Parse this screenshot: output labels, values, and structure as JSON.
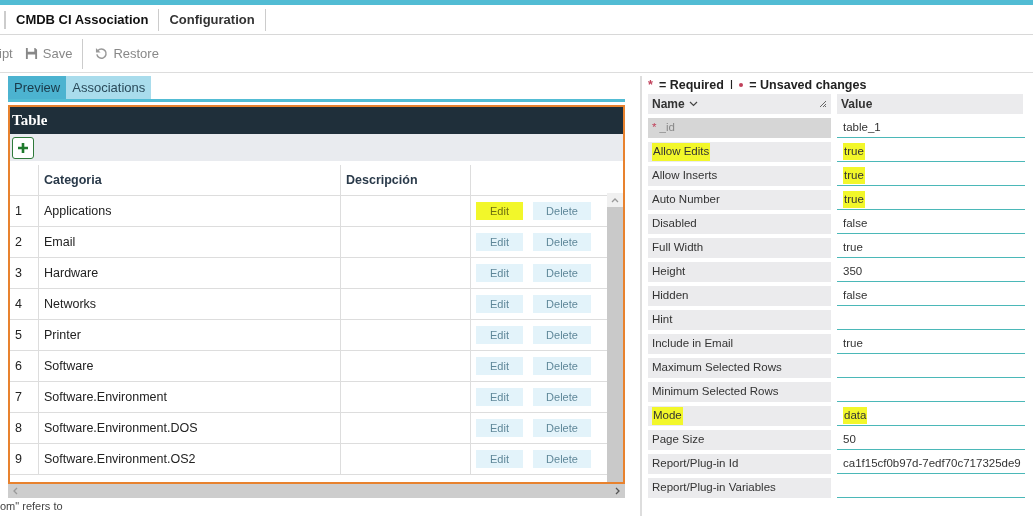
{
  "top_tabs": [
    {
      "label": "CMDB CI Association",
      "selected": true
    },
    {
      "label": "Configuration",
      "selected": false
    }
  ],
  "toolbar": [
    {
      "kind": "text",
      "label": "ipt"
    },
    {
      "kind": "save",
      "label": "Save"
    },
    {
      "kind": "restore",
      "label": "Restore"
    }
  ],
  "view_tabs": [
    {
      "label": "Preview",
      "selected": true
    },
    {
      "label": "Associations",
      "selected": false
    }
  ],
  "table": {
    "title": "Table",
    "columns": [
      "Categoria",
      "Descripción"
    ],
    "rows": [
      {
        "number": "1",
        "categoria": "Applications",
        "edit": "Edit",
        "delete": "Delete",
        "edit_highlighted": true
      },
      {
        "number": "2",
        "categoria": "Email",
        "edit": "Edit",
        "delete": "Delete",
        "edit_highlighted": false
      },
      {
        "number": "3",
        "categoria": "Hardware",
        "edit": "Edit",
        "delete": "Delete",
        "edit_highlighted": false
      },
      {
        "number": "4",
        "categoria": "Networks",
        "edit": "Edit",
        "delete": "Delete",
        "edit_highlighted": false
      },
      {
        "number": "5",
        "categoria": "Printer",
        "edit": "Edit",
        "delete": "Delete",
        "edit_highlighted": false
      },
      {
        "number": "6",
        "categoria": "Software",
        "edit": "Edit",
        "delete": "Delete",
        "edit_highlighted": false
      },
      {
        "number": "7",
        "categoria": "Software.Environment",
        "edit": "Edit",
        "delete": "Delete",
        "edit_highlighted": false
      },
      {
        "number": "8",
        "categoria": "Software.Environment.DOS",
        "edit": "Edit",
        "delete": "Delete",
        "edit_highlighted": false
      },
      {
        "number": "9",
        "categoria": "Software.Environment.OS2",
        "edit": "Edit",
        "delete": "Delete",
        "edit_highlighted": false
      }
    ]
  },
  "legend": {
    "required_mark": "*",
    "required": "= Required",
    "separator": "I",
    "unsaved": "= Unsaved changes"
  },
  "properties": {
    "columns": [
      "Name",
      "Value"
    ],
    "rows": [
      {
        "name": "_id",
        "value": "table_1",
        "required": true,
        "highlighted": false
      },
      {
        "name": "Allow Edits",
        "value": "true",
        "required": false,
        "highlighted": true,
        "value_highlighted": true
      },
      {
        "name": "Allow Inserts",
        "value": "true",
        "required": false,
        "highlighted": false,
        "value_highlighted": true
      },
      {
        "name": "Auto Number",
        "value": "true",
        "required": false,
        "highlighted": false,
        "value_highlighted": true
      },
      {
        "name": "Disabled",
        "value": "false",
        "required": false,
        "highlighted": false
      },
      {
        "name": "Full Width",
        "value": "true",
        "required": false,
        "highlighted": false
      },
      {
        "name": "Height",
        "value": "350",
        "required": false,
        "highlighted": false
      },
      {
        "name": "Hidden",
        "value": "false",
        "required": false,
        "highlighted": false
      },
      {
        "name": "Hint",
        "value": "",
        "required": false,
        "highlighted": false
      },
      {
        "name": "Include in Email",
        "value": "true",
        "required": false,
        "highlighted": false
      },
      {
        "name": "Maximum Selected Rows",
        "value": "",
        "required": false,
        "highlighted": false
      },
      {
        "name": "Minimum Selected Rows",
        "value": "",
        "required": false,
        "highlighted": false
      },
      {
        "name": "Mode",
        "value": "data",
        "required": false,
        "highlighted": true,
        "value_highlighted": true
      },
      {
        "name": "Page Size",
        "value": "50",
        "required": false,
        "highlighted": false
      },
      {
        "name": "Report/Plug-in Id",
        "value": "ca1f15cf0b97d-7edf70c717325de9",
        "required": false,
        "highlighted": false
      },
      {
        "name": "Report/Plug-in Variables",
        "value": "",
        "required": false,
        "highlighted": false
      }
    ]
  },
  "footer": "om\" refers to"
}
